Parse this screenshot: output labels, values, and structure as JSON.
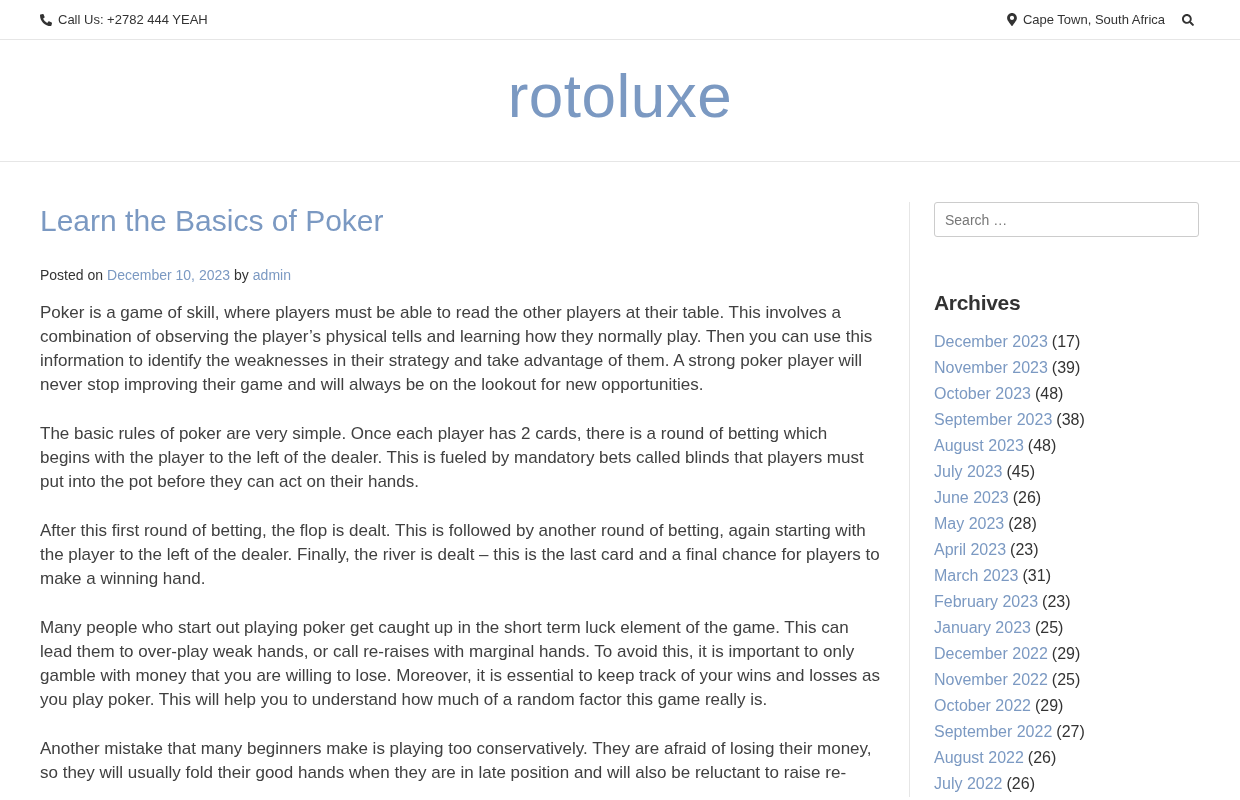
{
  "top_bar": {
    "phone": "Call Us: +2782 444 YEAH",
    "location": "Cape Town, South Africa"
  },
  "site_title": "rotoluxe",
  "post": {
    "title": "Learn the Basics of Poker",
    "meta": {
      "posted_on": "Posted on",
      "date": "December 10, 2023",
      "by": "by",
      "author": "admin"
    },
    "paragraphs": [
      "Poker is a game of skill, where players must be able to read the other players at their table. This involves a combination of observing the player’s physical tells and learning how they normally play. Then you can use this information to identify the weaknesses in their strategy and take advantage of them. A strong poker player will never stop improving their game and will always be on the lookout for new opportunities.",
      "The basic rules of poker are very simple. Once each player has 2 cards, there is a round of betting which begins with the player to the left of the dealer. This is fueled by mandatory bets called blinds that players must put into the pot before they can act on their hands.",
      "After this first round of betting, the flop is dealt. This is followed by another round of betting, again starting with the player to the left of the dealer. Finally, the river is dealt – this is the last card and a final chance for players to make a winning hand.",
      "Many people who start out playing poker get caught up in the short term luck element of the game. This can lead them to over-play weak hands, or call re-raises with marginal hands. To avoid this, it is important to only gamble with money that you are willing to lose. Moreover, it is essential to keep track of your wins and losses as you play poker. This will help you to understand how much of a random factor this game really is.",
      "Another mistake that many beginners make is playing too conservatively. They are afraid of losing their money, so they will usually fold their good hands when they are in late position and will also be reluctant to raise re-"
    ]
  },
  "sidebar": {
    "search": {
      "placeholder": "Search …"
    },
    "archives": {
      "title": "Archives",
      "items": [
        {
          "label": "December 2023",
          "count": "(17)"
        },
        {
          "label": "November 2023",
          "count": "(39)"
        },
        {
          "label": "October 2023",
          "count": "(48)"
        },
        {
          "label": "September 2023",
          "count": "(38)"
        },
        {
          "label": "August 2023",
          "count": "(48)"
        },
        {
          "label": "July 2023",
          "count": "(45)"
        },
        {
          "label": "June 2023",
          "count": "(26)"
        },
        {
          "label": "May 2023",
          "count": "(28)"
        },
        {
          "label": "April 2023",
          "count": "(23)"
        },
        {
          "label": "March 2023",
          "count": "(31)"
        },
        {
          "label": "February 2023",
          "count": "(23)"
        },
        {
          "label": "January 2023",
          "count": "(25)"
        },
        {
          "label": "December 2022",
          "count": "(29)"
        },
        {
          "label": "November 2022",
          "count": "(25)"
        },
        {
          "label": "October 2022",
          "count": "(29)"
        },
        {
          "label": "September 2022",
          "count": "(27)"
        },
        {
          "label": "August 2022",
          "count": "(26)"
        },
        {
          "label": "July 2022",
          "count": "(26)"
        }
      ]
    }
  }
}
